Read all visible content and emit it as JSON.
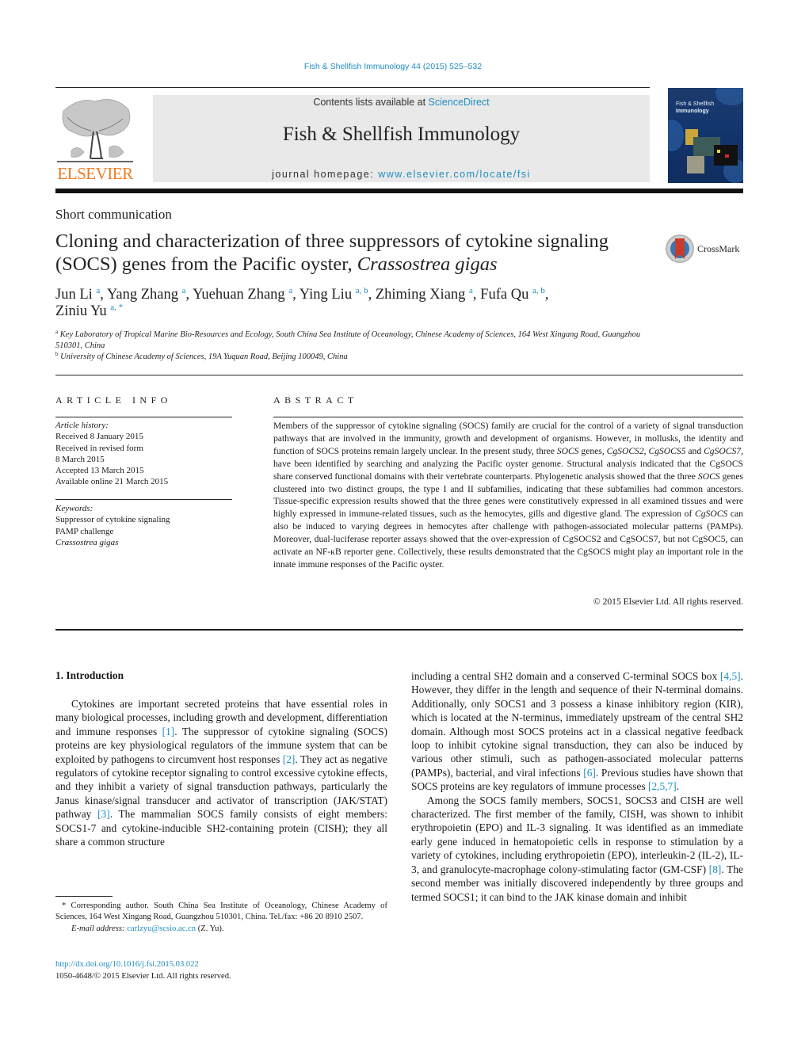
{
  "header": {
    "journal_ref": "Fish & Shellfish Immunology 44 (2015) 525–532",
    "contents_prefix": "Contents lists available at ",
    "contents_link": "ScienceDirect",
    "journal_title": "Fish & Shellfish Immunology",
    "homepage_prefix": "journal homepage: ",
    "homepage_link": "www.elsevier.com/locate/fsi",
    "publisher": "ELSEVIER",
    "cover_title_line1": "Fish & Shellfish",
    "cover_title_line2": "Immunology"
  },
  "article": {
    "type": "Short communication",
    "title_main": "Cloning and characterization of three suppressors of cytokine signaling (SOCS) genes from the Pacific oyster, ",
    "title_species": "Crassostrea gigas",
    "crossmark_label": "CrossMark",
    "authors": [
      {
        "name": "Jun Li",
        "aff": "a",
        "sep": ", "
      },
      {
        "name": "Yang Zhang",
        "aff": "a",
        "sep": ", "
      },
      {
        "name": "Yuehuan Zhang",
        "aff": "a",
        "sep": ", "
      },
      {
        "name": "Ying Liu",
        "aff": "a, b",
        "sep": ", "
      },
      {
        "name": "Zhiming Xiang",
        "aff": "a",
        "sep": ", "
      },
      {
        "name": "Fufa Qu",
        "aff": "a, b",
        "sep": ","
      },
      {
        "name": "Ziniu Yu",
        "aff": "a, *",
        "sep": ""
      }
    ],
    "affiliations": [
      {
        "key": "a",
        "text": "Key Laboratory of Tropical Marine Bio-Resources and Ecology, South China Sea Institute of Oceanology, Chinese Academy of Sciences, 164 West Xingang Road, Guangzhou 510301, China"
      },
      {
        "key": "b",
        "text": "University of Chinese Academy of Sciences, 19A Yuquan Road, Beijing 100049, China"
      }
    ]
  },
  "article_info": {
    "heading": "ARTICLE INFO",
    "history_label": "Article history:",
    "history": [
      "Received 8 January 2015",
      "Received in revised form",
      "8 March 2015",
      "Accepted 13 March 2015",
      "Available online 21 March 2015"
    ],
    "keywords_label": "Keywords:",
    "keywords": [
      "Suppressor of cytokine signaling",
      "PAMP challenge"
    ],
    "keyword_italic": "Crassostrea gigas"
  },
  "abstract": {
    "heading": "ABSTRACT",
    "segments": [
      {
        "t": "Members of the suppressor of cytokine signaling (SOCS) family are crucial for the control of a variety of signal transduction pathways that are involved in the immunity, growth and development of organisms. However, in mollusks, the identity and function of SOCS proteins remain largely unclear. In the present study, three "
      },
      {
        "t": "SOCS",
        "i": true
      },
      {
        "t": " genes, "
      },
      {
        "t": "CgSOCS2",
        "i": true
      },
      {
        "t": ", "
      },
      {
        "t": "CgSOCS5",
        "i": true
      },
      {
        "t": " and "
      },
      {
        "t": "CgSOCS7",
        "i": true
      },
      {
        "t": ", have been identified by searching and analyzing the Pacific oyster genome. Structural analysis indicated that the CgSOCS share conserved functional domains with their vertebrate counterparts. Phylogenetic analysis showed that the three "
      },
      {
        "t": "SOCS",
        "i": true
      },
      {
        "t": " genes clustered into two distinct groups, the type I and II subfamilies, indicating that these subfamilies had common ancestors. Tissue-specific expression results showed that the three genes were constitutively expressed in all examined tissues and were highly expressed in immune-related tissues, such as the hemocytes, gills and digestive gland. The expression of "
      },
      {
        "t": "CgSOCS",
        "i": true
      },
      {
        "t": " can also be induced to varying degrees in hemocytes after challenge with pathogen-associated molecular patterns (PAMPs). Moreover, dual-luciferase reporter assays showed that the over-expression of CgSOCS2 and CgSOCS7, but not CgSOC5, can activate an NF-κB reporter gene. Collectively, these results demonstrated that the CgSOCS might play an important role in the innate immune responses of the Pacific oyster."
      }
    ],
    "copyright": "© 2015 Elsevier Ltd. All rights reserved."
  },
  "body": {
    "section_heading": "1.  Introduction",
    "left_col": [
      {
        "t": "Cytokines are important secreted proteins that have essential roles in many biological processes, including growth and devel­opment, differentiation and immune responses "
      },
      {
        "t": "[1]",
        "ref": true
      },
      {
        "t": ". The suppressor of cytokine signaling (SOCS) proteins are key physiological regu­lators of the immune system that can be exploited by pathogens to circumvent host responses "
      },
      {
        "t": "[2]",
        "ref": true
      },
      {
        "t": ". They act as negative regulators of cytokine receptor signaling to control excessive cytokine effects, and they inhibit a variety of signal transduction pathways, partic­ularly the Janus kinase/signal transducer and activator of tran­scription (JAK/STAT) pathway "
      },
      {
        "t": "[3]",
        "ref": true
      },
      {
        "t": ". The mammalian SOCS family consists of eight members: SOCS1-7 and cytokine-inducible SH2-containing protein (CISH); they all share a common structure"
      }
    ],
    "right_col_p1": [
      {
        "t": "including a central SH2 domain and a conserved C-terminal SOCS box "
      },
      {
        "t": "[4,5]",
        "ref": true
      },
      {
        "t": ". However, they differ in the length and sequence of their N-terminal domains. Additionally, only SOCS1 and 3 possess a ki­nase inhibitory region (KIR), which is located at the N-terminus, immediately upstream of the central SH2 domain. Although most SOCS proteins act in a classical negative feedback loop to inhibit cytokine signal transduction, they can also be induced by various other stimuli, such as pathogen-associated molecular patterns (PAMPs), bacterial, and viral infections "
      },
      {
        "t": "[6]",
        "ref": true
      },
      {
        "t": ". Previous studies have shown that SOCS proteins are key regulators of immune processes "
      },
      {
        "t": "[2,5,7]",
        "ref": true
      },
      {
        "t": "."
      }
    ],
    "right_col_p2": [
      {
        "t": "Among the SOCS family members, SOCS1, SOCS3 and CISH are well characterized. The first member of the family, CISH, was shown to inhibit erythropoietin (EPO) and IL-3 signaling. It was identified as an immediate early gene induced in hematopoietic cells in response to stimulation by a variety of cytokines, including eryth­ropoietin (EPO), interleukin-2 (IL-2), IL-3, and granulocyte-macrophage colony-stimulating factor (GM-CSF) "
      },
      {
        "t": "[8]",
        "ref": true
      },
      {
        "t": ". The second member was initially discovered independently by three groups and termed SOCS1; it can bind to the JAK kinase domain and inhibit"
      }
    ]
  },
  "footnote": {
    "corresponding": "* Corresponding author. South China Sea Institute of Oceanology, Chinese Academy of Sciences, 164 West Xingang Road, Guangzhou 510301, China. Tel./fax: +86 20 8910 2507.",
    "email_label": "E-mail address: ",
    "email": "carlzyu@scsio.ac.cn",
    "email_suffix": " (Z. Yu).",
    "doi": "http://dx.doi.org/10.1016/j.fsi.2015.03.022",
    "issn": "1050-4648/© 2015 Elsevier Ltd. All rights reserved."
  },
  "colors": {
    "link": "#1f8ec1",
    "elsevier_orange": "#f47920",
    "header_box": "#e9e9e9"
  }
}
